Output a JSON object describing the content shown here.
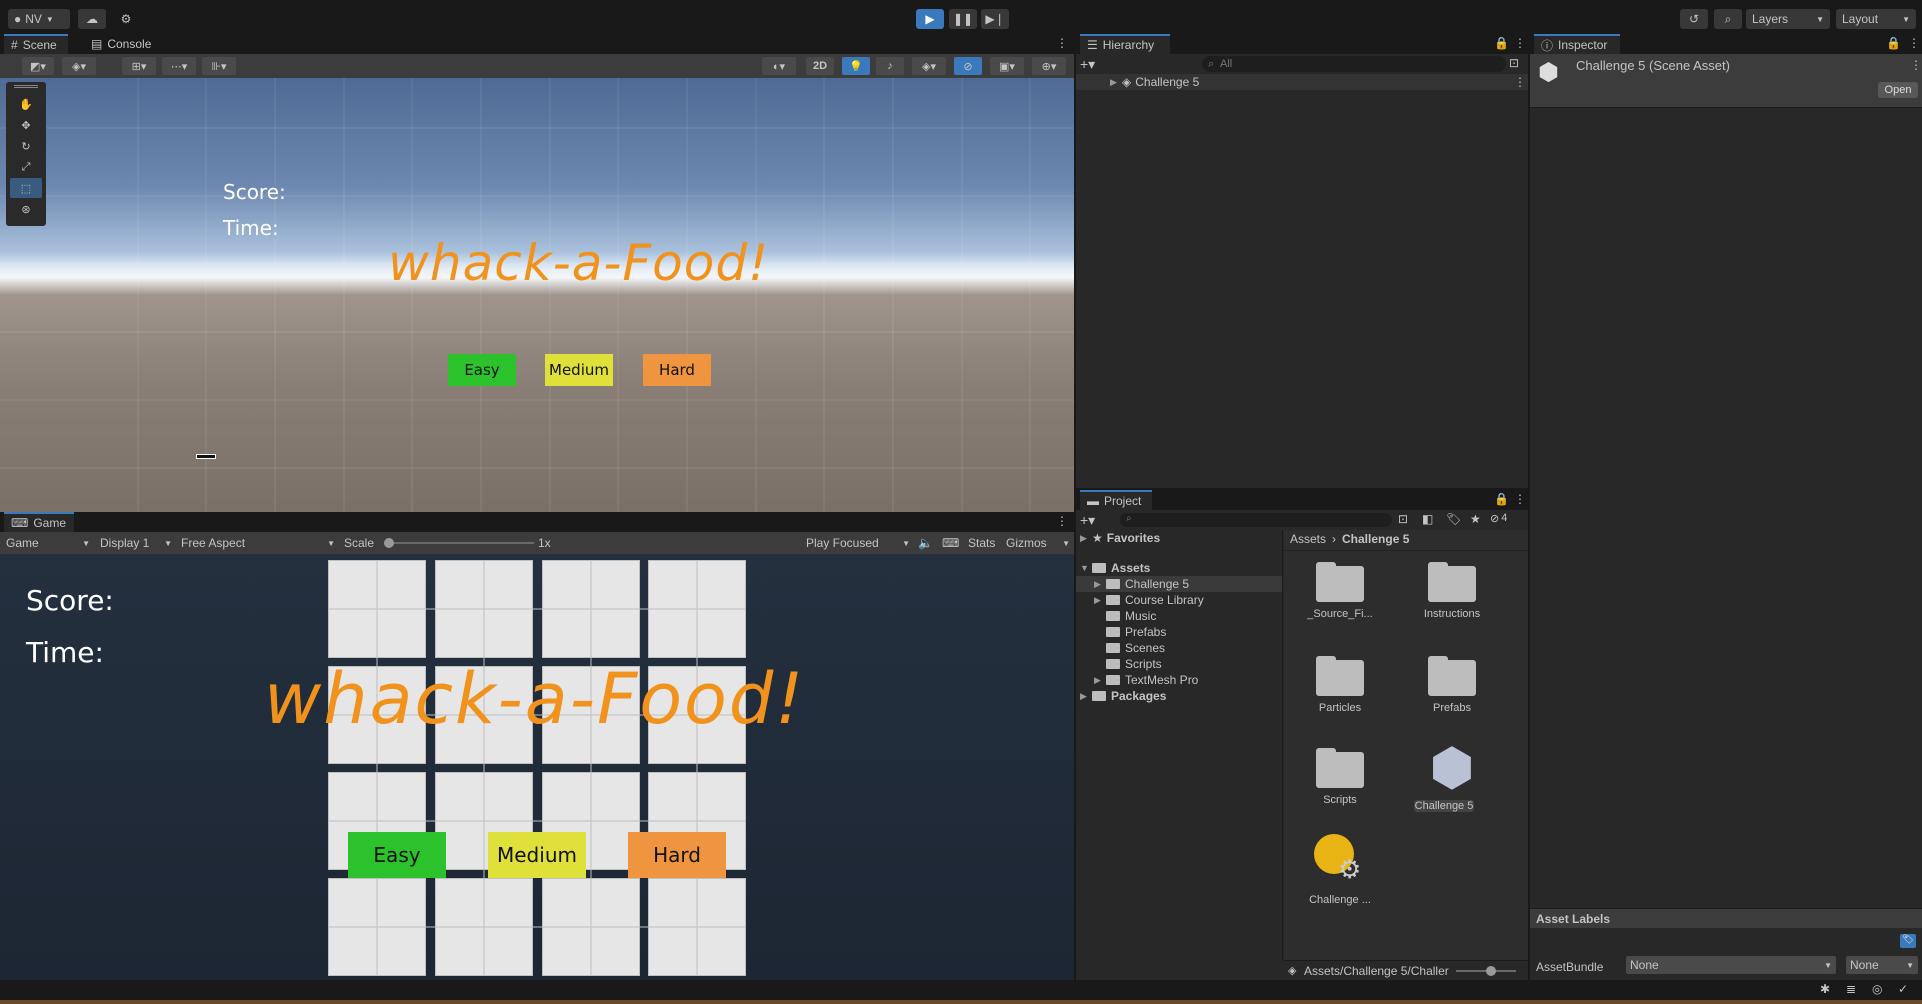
{
  "topbar": {
    "account": "NV",
    "layers": "Layers",
    "layout": "Layout"
  },
  "scene_panel": {
    "tabs": [
      "Scene",
      "Console"
    ],
    "mode_2d": "2D",
    "score_label": "Score:",
    "time_label": "Time:",
    "title": "whack-a-Food!",
    "buttons": [
      "Easy",
      "Medium",
      "Hard"
    ]
  },
  "game_panel": {
    "tab": "Game",
    "game_dropdown": "Game",
    "display": "Display 1",
    "aspect": "Free Aspect",
    "scale_label": "Scale",
    "scale_value": "1x",
    "play_focused": "Play Focused",
    "stats": "Stats",
    "gizmos": "Gizmos",
    "score_label": "Score:",
    "time_label": "Time:",
    "title": "whack-a-Food!",
    "buttons": [
      "Easy",
      "Medium",
      "Hard"
    ]
  },
  "hierarchy": {
    "tab": "Hierarchy",
    "search_placeholder": "All",
    "root": "Challenge 5"
  },
  "inspector": {
    "tab": "Inspector",
    "title": "Challenge 5 (Scene Asset)",
    "open": "Open",
    "asset_labels": "Asset Labels",
    "asset_bundle_label": "AssetBundle",
    "asset_bundle_value": "None",
    "asset_bundle_variant": "None"
  },
  "project": {
    "tab": "Project",
    "hidden_count": "4",
    "favorites": "Favorites",
    "assets": "Assets",
    "asset_folders": [
      "Challenge 5",
      "Course Library",
      "Music",
      "Prefabs",
      "Scenes",
      "Scripts",
      "TextMesh Pro"
    ],
    "packages": "Packages",
    "breadcrumb_root": "Assets",
    "breadcrumb_current": "Challenge 5",
    "grid_items": [
      "_Source_Fi...",
      "Instructions",
      "Particles",
      "Prefabs",
      "Scripts",
      "Challenge 5",
      "Challenge ..."
    ],
    "path": "Assets/Challenge 5/Challer"
  },
  "colors": {
    "accent": "#3a79bb",
    "title_orange": "#f0921c",
    "easy": "#2bc22b",
    "medium": "#e0e03a",
    "hard": "#ef9540"
  }
}
